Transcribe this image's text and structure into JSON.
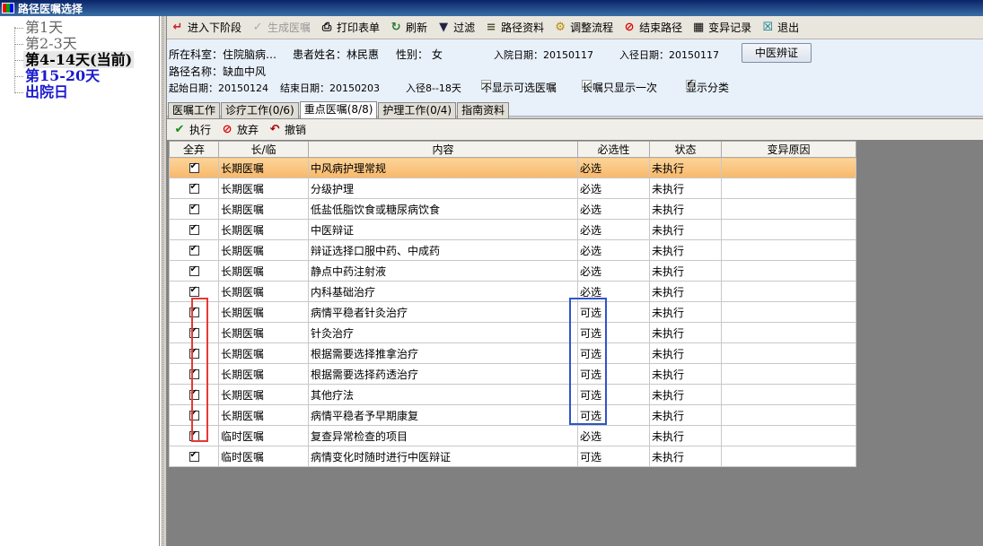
{
  "window": {
    "title": "路径医嘱选择"
  },
  "tree": {
    "items": [
      {
        "label": "第1天",
        "state": "done"
      },
      {
        "label": "第2-3天",
        "state": "done"
      },
      {
        "label": "第4-14天(当前)",
        "state": "current"
      },
      {
        "label": "第15-20天",
        "state": "future"
      },
      {
        "label": "出院日",
        "state": "future"
      }
    ]
  },
  "toolbar": {
    "next_stage": "进入下阶段",
    "gen_orders": "生成医嘱",
    "print_form": "打印表单",
    "refresh": "刷新",
    "filter": "过滤",
    "path_info": "路径资料",
    "adjust_flow": "调整流程",
    "end_path": "结束路径",
    "variance_log": "变异记录",
    "exit": "退出"
  },
  "patient": {
    "dept": "所在科室：住院脑病…",
    "name": "患者姓名：林民惠",
    "gender": "性别： 女",
    "admit_date": "入院日期：20150117",
    "path_entry_date": "入径日期：20150117",
    "tcm_button": "中医辨证",
    "path_name": "路径名称：缺血中风",
    "start_date": "起始日期：20150124",
    "end_date": "结束日期：20150203",
    "path_range": "入径8--18天",
    "opt_hide_optional": "不显示可选医嘱",
    "opt_long_once": "长嘱只显示一次",
    "opt_show_category": "显示分类"
  },
  "tabs": [
    {
      "label": "医嘱工作"
    },
    {
      "label": "诊疗工作(0/6)"
    },
    {
      "label": "重点医嘱(8/8)"
    },
    {
      "label": "护理工作(0/4)"
    },
    {
      "label": "指南资料"
    }
  ],
  "actions": {
    "execute": "执行",
    "discard": "放弃",
    "undo": "撤销"
  },
  "grid": {
    "headers": [
      "全弃",
      "长/临",
      "内容",
      "必选性",
      "状态",
      "变异原因"
    ],
    "rows": [
      {
        "type": "长期医嘱",
        "content": "中风病护理常规",
        "required": "必选",
        "status": "未执行",
        "reason": ""
      },
      {
        "type": "长期医嘱",
        "content": "分级护理",
        "required": "必选",
        "status": "未执行",
        "reason": ""
      },
      {
        "type": "长期医嘱",
        "content": "低盐低脂饮食或糖尿病饮食",
        "required": "必选",
        "status": "未执行",
        "reason": ""
      },
      {
        "type": "长期医嘱",
        "content": "中医辩证",
        "required": "必选",
        "status": "未执行",
        "reason": ""
      },
      {
        "type": "长期医嘱",
        "content": "辩证选择口服中药、中成药",
        "required": "必选",
        "status": "未执行",
        "reason": ""
      },
      {
        "type": "长期医嘱",
        "content": "静点中药注射液",
        "required": "必选",
        "status": "未执行",
        "reason": ""
      },
      {
        "type": "长期医嘱",
        "content": "内科基础治疗",
        "required": "必选",
        "status": "未执行",
        "reason": ""
      },
      {
        "type": "长期医嘱",
        "content": "病情平稳者针灸治疗",
        "required": "可选",
        "status": "未执行",
        "reason": ""
      },
      {
        "type": "长期医嘱",
        "content": "针灸治疗",
        "required": "可选",
        "status": "未执行",
        "reason": ""
      },
      {
        "type": "长期医嘱",
        "content": "根据需要选择推拿治疗",
        "required": "可选",
        "status": "未执行",
        "reason": ""
      },
      {
        "type": "长期医嘱",
        "content": "根据需要选择药透治疗",
        "required": "可选",
        "status": "未执行",
        "reason": ""
      },
      {
        "type": "长期医嘱",
        "content": "其他疗法",
        "required": "可选",
        "status": "未执行",
        "reason": ""
      },
      {
        "type": "长期医嘱",
        "content": "病情平稳者予早期康复",
        "required": "可选",
        "status": "未执行",
        "reason": ""
      },
      {
        "type": "临时医嘱",
        "content": "复查异常检查的项目",
        "required": "必选",
        "status": "未执行",
        "reason": ""
      },
      {
        "type": "临时医嘱",
        "content": "病情变化时随时进行中医辩证",
        "required": "可选",
        "status": "未执行",
        "reason": ""
      }
    ]
  }
}
